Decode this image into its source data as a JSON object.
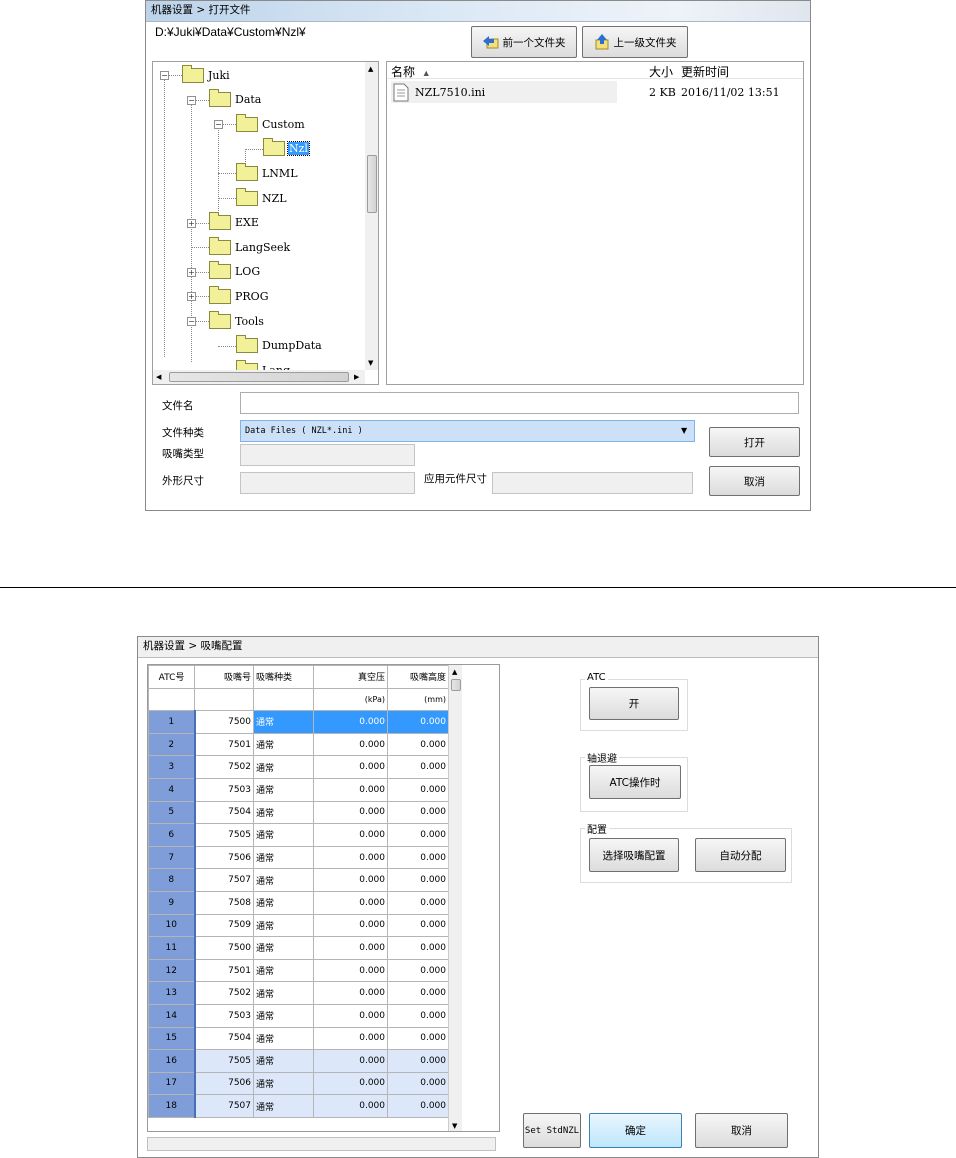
{
  "dialog1": {
    "title": "机器设置 > 打开文件",
    "path": "D:¥Juki¥Data¥Custom¥Nzl¥",
    "btn_prev": "前一个文件夹",
    "btn_up": "上一级文件夹",
    "tree": [
      {
        "label": "Juki",
        "level": 0,
        "exp": "−"
      },
      {
        "label": "Data",
        "level": 1,
        "exp": "−"
      },
      {
        "label": "Custom",
        "level": 2,
        "exp": "−"
      },
      {
        "label": "Nzl",
        "level": 3,
        "selected": true
      },
      {
        "label": "LNML",
        "level": 2
      },
      {
        "label": "NZL",
        "level": 2
      },
      {
        "label": "EXE",
        "level": 1,
        "exp": "+"
      },
      {
        "label": "LangSeek",
        "level": 1
      },
      {
        "label": "LOG",
        "level": 1,
        "exp": "+"
      },
      {
        "label": "PROG",
        "level": 1,
        "exp": "+"
      },
      {
        "label": "Tools",
        "level": 1,
        "exp": "−"
      },
      {
        "label": "DumpData",
        "level": 2
      },
      {
        "label": "Lang",
        "level": 2
      }
    ],
    "list_headers": {
      "name": "名称",
      "size": "大小",
      "time": "更新时间"
    },
    "files": [
      {
        "name": "NZL7510.ini",
        "size": "2 KB",
        "time": "2016/11/02 13:51"
      }
    ],
    "lbl_filename": "文件名",
    "filename": "",
    "lbl_filetype": "文件种类",
    "filetype": "Data Files ( NZL*.ini )",
    "lbl_nozzle_type": "吸嘴类型",
    "lbl_outer": "外形尺寸",
    "lbl_component": "应用元件尺寸",
    "btn_open": "打开",
    "btn_cancel": "取消"
  },
  "dialog2": {
    "title": "机器设置 > 吸嘴配置",
    "headers": [
      "ATC号",
      "吸嘴号",
      "吸嘴种类",
      "真空压",
      "吸嘴高度"
    ],
    "units": [
      "",
      "",
      "",
      "(kPa)",
      "(mm)"
    ],
    "rows": [
      [
        "1",
        "7500",
        "通常",
        "0.000",
        "0.000"
      ],
      [
        "2",
        "7501",
        "通常",
        "0.000",
        "0.000"
      ],
      [
        "3",
        "7502",
        "通常",
        "0.000",
        "0.000"
      ],
      [
        "4",
        "7503",
        "通常",
        "0.000",
        "0.000"
      ],
      [
        "5",
        "7504",
        "通常",
        "0.000",
        "0.000"
      ],
      [
        "6",
        "7505",
        "通常",
        "0.000",
        "0.000"
      ],
      [
        "7",
        "7506",
        "通常",
        "0.000",
        "0.000"
      ],
      [
        "8",
        "7507",
        "通常",
        "0.000",
        "0.000"
      ],
      [
        "9",
        "7508",
        "通常",
        "0.000",
        "0.000"
      ],
      [
        "10",
        "7509",
        "通常",
        "0.000",
        "0.000"
      ],
      [
        "11",
        "7500",
        "通常",
        "0.000",
        "0.000"
      ],
      [
        "12",
        "7501",
        "通常",
        "0.000",
        "0.000"
      ],
      [
        "13",
        "7502",
        "通常",
        "0.000",
        "0.000"
      ],
      [
        "14",
        "7503",
        "通常",
        "0.000",
        "0.000"
      ],
      [
        "15",
        "7504",
        "通常",
        "0.000",
        "0.000"
      ],
      [
        "16",
        "7505",
        "通常",
        "0.000",
        "0.000"
      ],
      [
        "17",
        "7506",
        "通常",
        "0.000",
        "0.000"
      ],
      [
        "18",
        "7507",
        "通常",
        "0.000",
        "0.000"
      ]
    ],
    "atc_group": "ATC",
    "btn_on": "开",
    "retract_group": "轴退避",
    "btn_atc_op": "ATC操作时",
    "config_group": "配置",
    "btn_select": "选择吸嘴配置",
    "btn_auto": "自动分配",
    "btn_set_std": "Set StdNZL",
    "btn_ok": "确定",
    "btn_cancel": "取消"
  },
  "colors": {
    "selection": "#3399ff",
    "row_header": "#7f9ed9",
    "light_row": "#dce8fa",
    "combo": "#cce0f7"
  }
}
